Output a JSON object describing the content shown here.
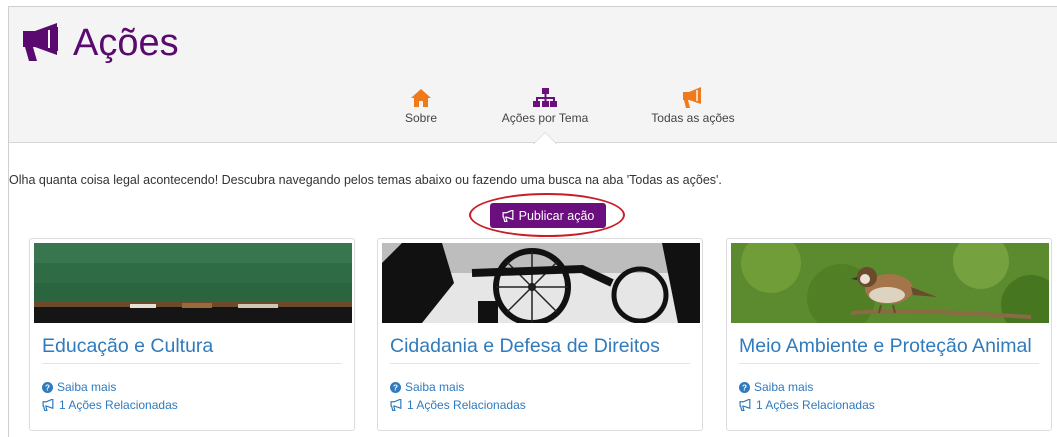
{
  "header": {
    "title": "Ações"
  },
  "tabs": [
    {
      "label": "Sobre",
      "icon": "home-icon",
      "color": "#f07a1a"
    },
    {
      "label": "Ações por Tema",
      "icon": "sitemap-icon",
      "color": "#6a0f7d"
    },
    {
      "label": "Todas as ações",
      "icon": "megaphone-icon",
      "color": "#f07a1a"
    }
  ],
  "intro_text": "Olha quanta coisa legal acontecendo! Descubra navegando pelos temas abaixo ou fazendo uma busca na aba 'Todas as ações'.",
  "publish_button": {
    "label": "Publicar ação"
  },
  "cards": [
    {
      "title": "Educação e Cultura",
      "more_label": "Saiba mais",
      "related_label": "1 Ações Relacionadas"
    },
    {
      "title": "Cidadania e Defesa de Direitos",
      "more_label": "Saiba mais",
      "related_label": "1 Ações Relacionadas"
    },
    {
      "title": "Meio Ambiente e Proteção Animal",
      "more_label": "Saiba mais",
      "related_label": "1 Ações Relacionadas"
    }
  ],
  "colors": {
    "brand": "#5a0a6e",
    "accent": "#f07a1a",
    "link": "#2f7bbd",
    "highlight_circle": "#c81e28"
  }
}
